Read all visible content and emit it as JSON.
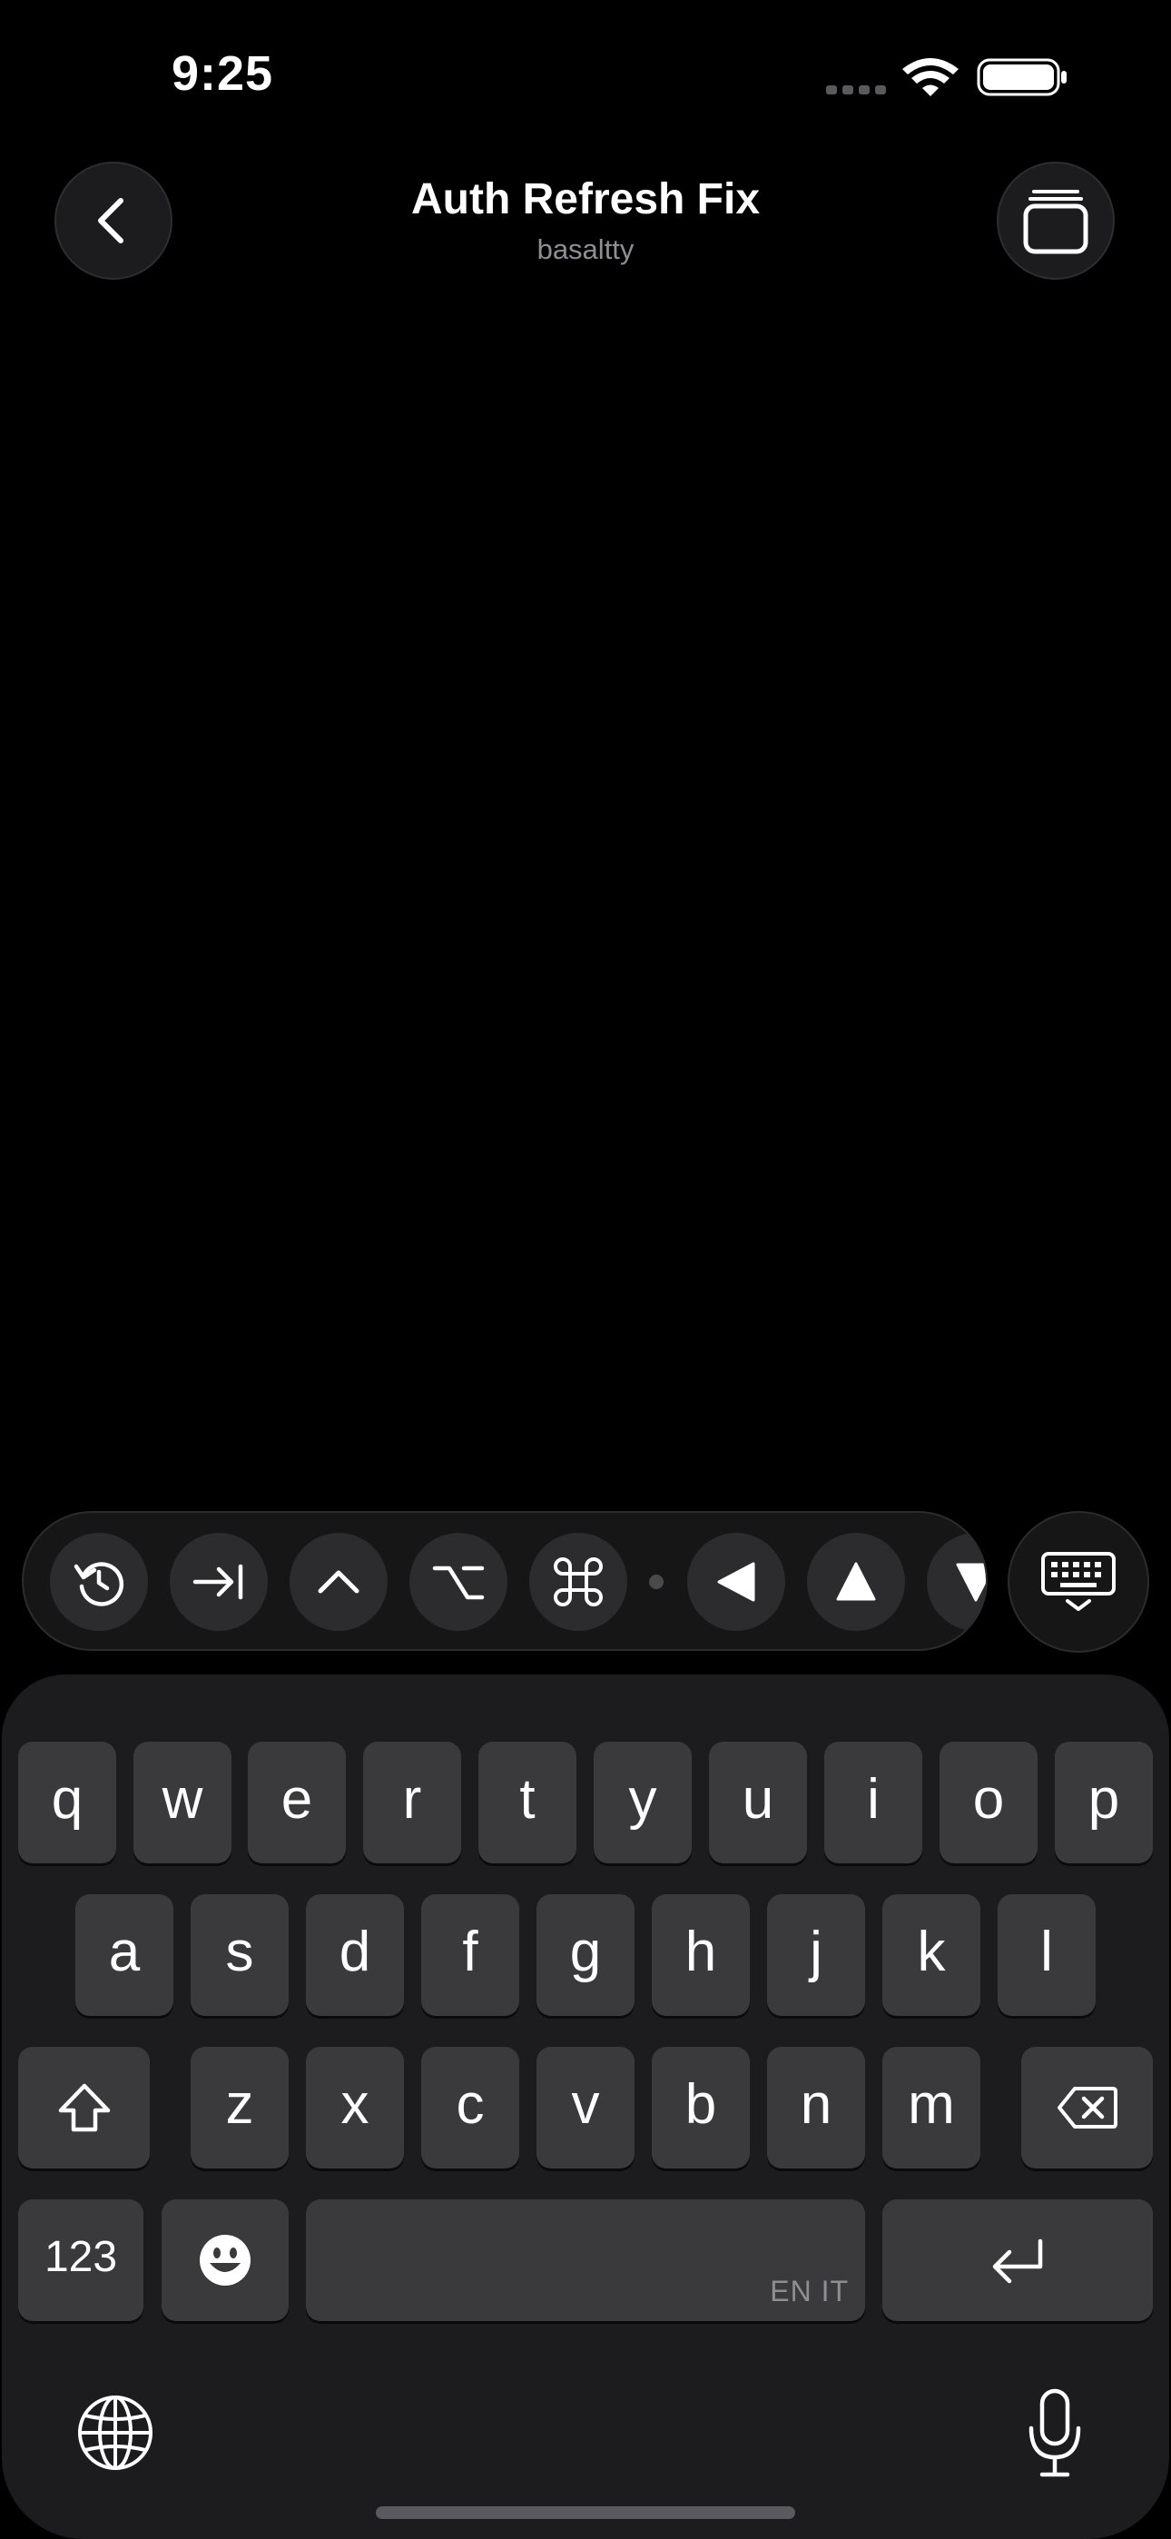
{
  "status_bar": {
    "time": "9:25"
  },
  "nav": {
    "title": "Auth Refresh Fix",
    "subtitle": "basaltty",
    "back_icon": "chevron-left-icon",
    "tabs_icon": "stacked-windows-icon"
  },
  "toolbar": {
    "buttons": [
      "history-icon",
      "tab-key-icon",
      "control-key-icon",
      "option-key-icon",
      "command-key-icon",
      "arrow-left-icon",
      "arrow-up-icon",
      "arrow-down-icon"
    ],
    "dismiss_icon": "keyboard-dismiss-icon"
  },
  "keyboard": {
    "row1": [
      "q",
      "w",
      "e",
      "r",
      "t",
      "y",
      "u",
      "i",
      "o",
      "p"
    ],
    "row2": [
      "a",
      "s",
      "d",
      "f",
      "g",
      "h",
      "j",
      "k",
      "l"
    ],
    "row3": [
      "z",
      "x",
      "c",
      "v",
      "b",
      "n",
      "m"
    ],
    "numbers_label": "123",
    "space_languages": "EN IT",
    "shift_icon": "shift-icon",
    "delete_icon": "delete-icon",
    "emoji_icon": "emoji-icon",
    "return_icon": "return-icon",
    "globe_icon": "globe-icon",
    "mic_icon": "microphone-icon"
  }
}
